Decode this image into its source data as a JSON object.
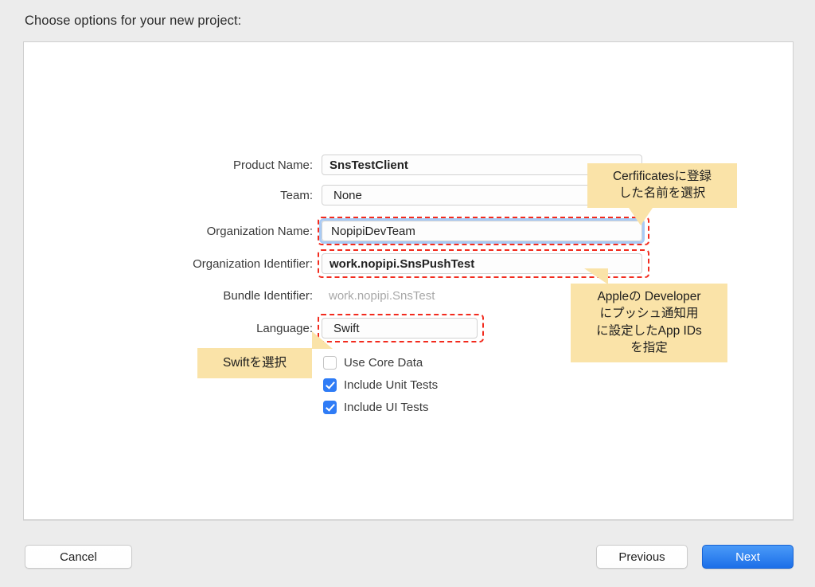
{
  "dialog": {
    "title": "Choose options for your new project:"
  },
  "form": {
    "fields": [
      {
        "label": "Product Name:",
        "value": "SnsTestClient"
      },
      {
        "label": "Team:",
        "value": "None"
      },
      {
        "label": "Organization Name:",
        "value": "NopipiDevTeam"
      },
      {
        "label": "Organization Identifier:",
        "value": "work.nopipi.SnsPushTest"
      },
      {
        "label": "Bundle Identifier:",
        "value": "work.nopipi.SnsTest"
      },
      {
        "label": "Language:",
        "value": "Swift"
      }
    ],
    "checkboxes": [
      {
        "label": "Use Core Data",
        "checked": false
      },
      {
        "label": "Include Unit Tests",
        "checked": true
      },
      {
        "label": "Include UI Tests",
        "checked": true
      }
    ]
  },
  "annotations": [
    {
      "line1": "Cerfificatesに登録",
      "line2": "した名前を選択"
    },
    {
      "line1": "Appleの Developer",
      "line2": "にプッシュ通知用",
      "line3": "に設定したApp IDs",
      "line4": "を指定"
    },
    {
      "line1": "Swiftを選択"
    }
  ],
  "footer": {
    "cancel": "Cancel",
    "previous": "Previous",
    "next": "Next"
  },
  "colors": {
    "highlight_box": "#f22b1e",
    "callout_bg": "#fae3a8",
    "focus_ring": "#a9cbf5",
    "primary_button": "#1c6fe8",
    "checkbox_checked": "#2f7cf6"
  }
}
